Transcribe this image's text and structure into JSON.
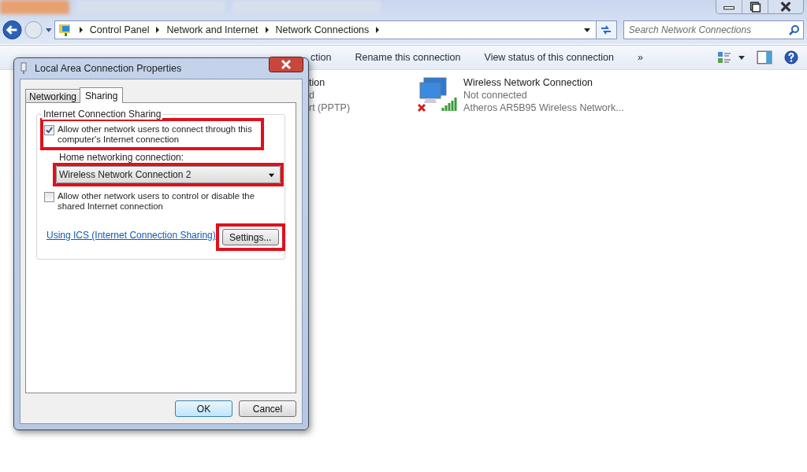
{
  "address_bar": {
    "breadcrumbs": [
      "Control Panel",
      "Network and Internet",
      "Network Connections"
    ]
  },
  "search": {
    "placeholder": "Search Network Connections"
  },
  "toolbar": [
    {
      "label": "ction",
      "kind": "partial"
    },
    {
      "label": "Rename this connection",
      "kind": "command"
    },
    {
      "label": "View status of this connection",
      "kind": "command"
    },
    {
      "label": "»",
      "kind": "more"
    }
  ],
  "connections": [
    {
      "kind": "partial",
      "name": "tion",
      "status": "d",
      "device": "rt (PPTP)"
    },
    {
      "kind": "wireless",
      "name": "Wireless Network Connection",
      "status": "Not connected",
      "device": "Atheros AR5B95 Wireless Network..."
    }
  ],
  "dialog": {
    "title": "Local Area Connection Properties",
    "tabs": [
      {
        "label": "Networking",
        "selected": false
      },
      {
        "label": "Sharing",
        "selected": true
      }
    ],
    "group_title": "Internet Connection Sharing",
    "options": [
      {
        "label": "Allow other network users to connect through this computer's Internet connection",
        "checked": true,
        "highlighted": true
      },
      {
        "label": "Allow other network users to control or disable the shared Internet connection",
        "checked": false,
        "highlighted": false
      }
    ],
    "home_label": "Home networking connection:",
    "home_select": {
      "value": "Wireless Network Connection 2",
      "highlighted": true
    },
    "link": "Using ICS (Internet Connection Sharing)",
    "settings_button": {
      "label": "Settings...",
      "highlighted": true
    },
    "buttons": [
      {
        "label": "OK",
        "default": true
      },
      {
        "label": "Cancel",
        "default": false
      }
    ]
  }
}
